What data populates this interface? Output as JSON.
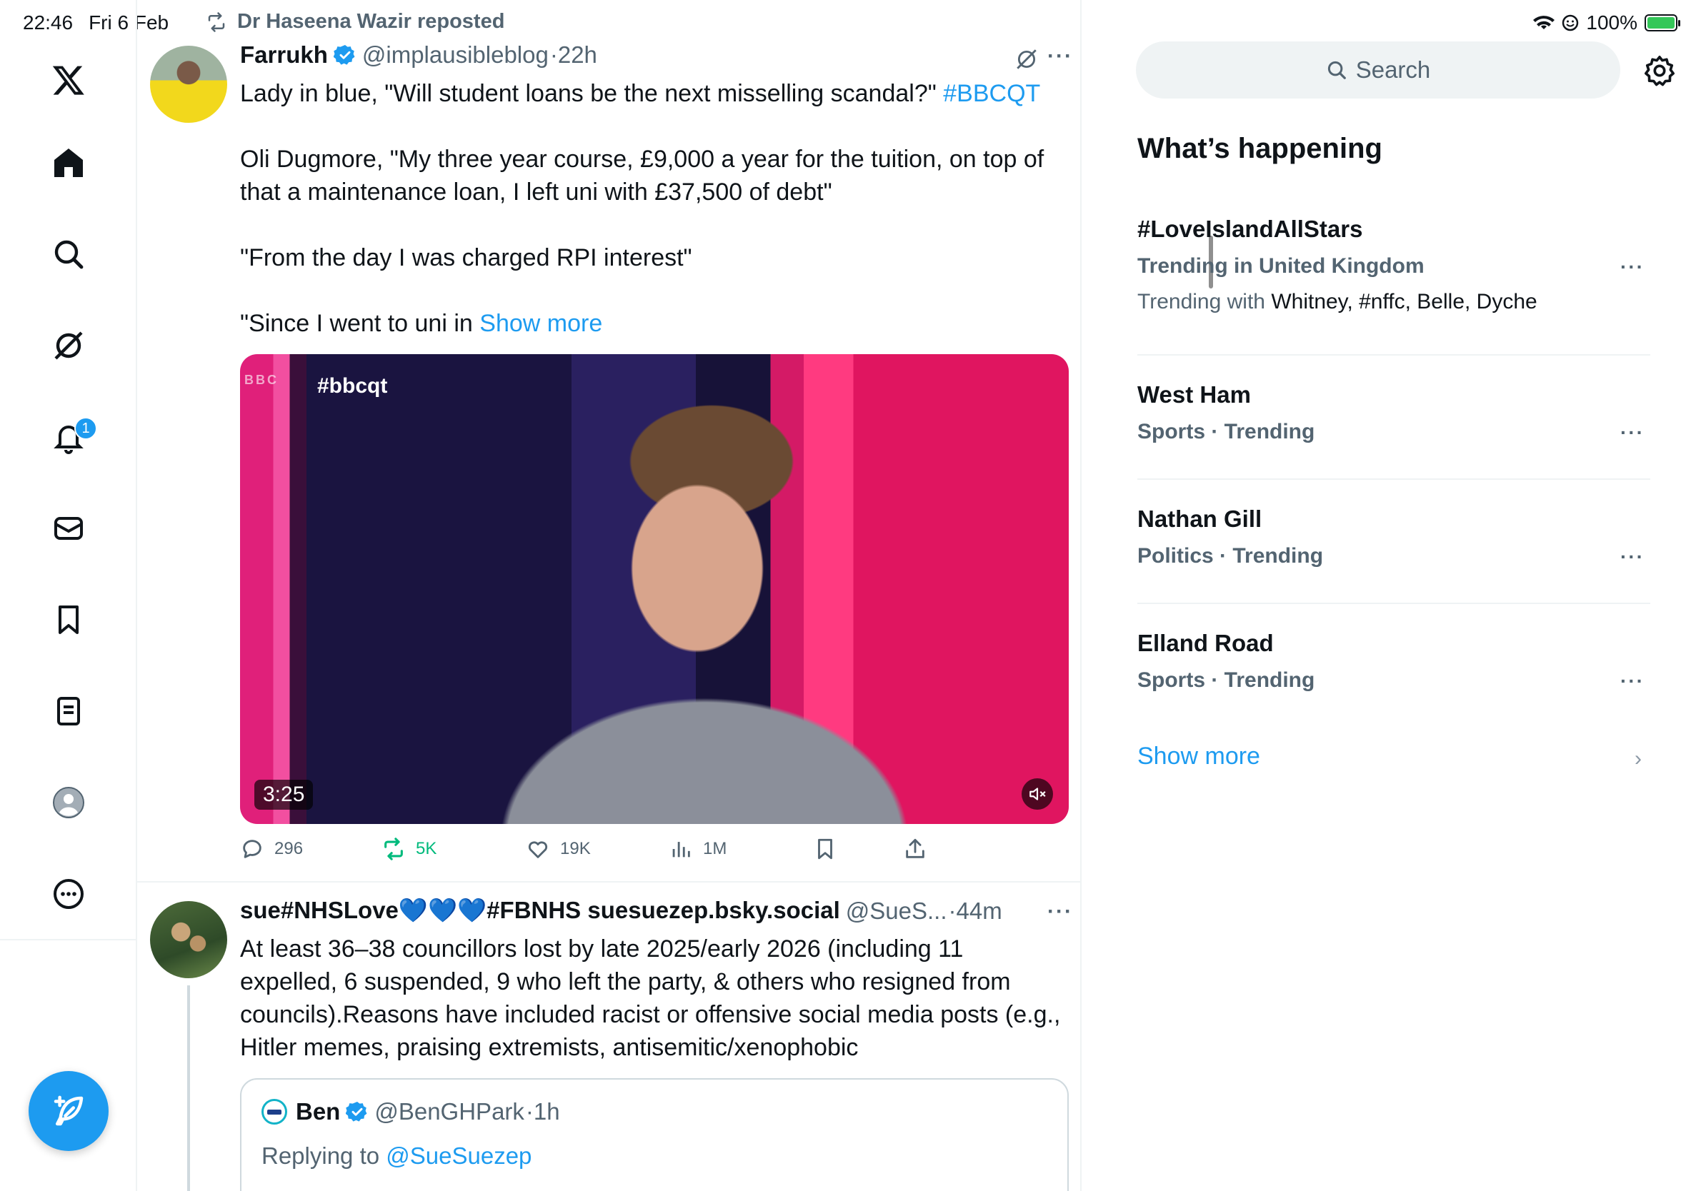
{
  "status_bar": {
    "time": "22:46",
    "date": "Fri 6 Feb",
    "battery": "100%"
  },
  "nav": {
    "notifications_badge": "1"
  },
  "feed": {
    "repost_label": "Dr Haseena Wazir reposted",
    "tweet1": {
      "name": "Farrukh",
      "handle": "@implausibleblog",
      "time": "·22h",
      "line1": "Lady in blue, \"Will student loans be the next misselling scandal?\" ",
      "hashtag": "#BBCQT",
      "para2": "Oli Dugmore, \"My three year course, £9,000 a year for the tuition, on top of that a maintenance loan, I left uni with £37,500 of debt\"",
      "para3": "\"From the day I was charged RPI interest\"",
      "para4": "\"Since I went to uni in ",
      "show_more": "Show more",
      "media": {
        "overlay_tag": "#bbcqt",
        "logo_text": "BBC",
        "duration": "3:25"
      },
      "stats": {
        "replies": "296",
        "reposts": "5K",
        "likes": "19K",
        "views": "1M"
      }
    },
    "tweet2": {
      "name": "sue#NHSLove💙💙💙#FBNHS suesuezep.bsky.social",
      "handle": "@SueS...",
      "time": "·44m",
      "text": "At least 36–38 councillors lost by late 2025/early 2026 (including 11 expelled, 6 suspended, 9 who left the party, & others who resigned from councils).Reasons have included racist or offensive social media posts (e.g., Hitler memes, praising extremists, antisemitic/xenophobic",
      "quote": {
        "name": "Ben",
        "handle": "@BenGHPark",
        "time": "·1h",
        "replying_prefix": "Replying to ",
        "replying_to": "@SueSuezep"
      }
    }
  },
  "sidebar": {
    "search_placeholder": "Search",
    "title": "What’s happening",
    "trends": [
      {
        "name": "#LoveIslandAllStars",
        "meta": "Trending in United Kingdom",
        "with_prefix": "Trending with ",
        "with": "Whitney, #nffc, Belle, Dyche"
      },
      {
        "name": "West Ham",
        "meta": "Sports · Trending"
      },
      {
        "name": "Nathan Gill",
        "meta": "Politics · Trending"
      },
      {
        "name": "Elland Road",
        "meta": "Sports · Trending"
      }
    ],
    "show_more": "Show more"
  },
  "colors": {
    "accent": "#1d9bf0",
    "repost_green": "#00ba7c",
    "muted": "#536471"
  }
}
